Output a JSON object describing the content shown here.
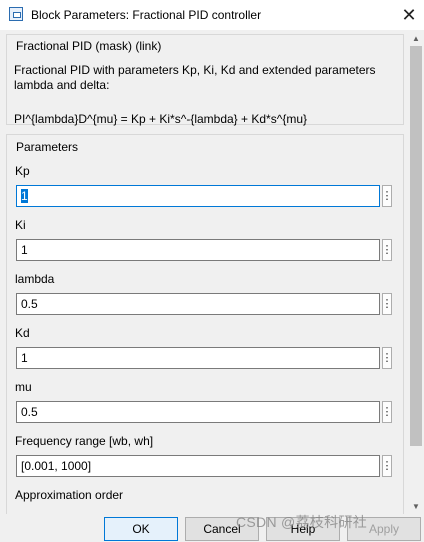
{
  "window": {
    "title": "Block Parameters: Fractional PID controller",
    "close_symbol": "✕"
  },
  "description": {
    "group_title": "Fractional PID (mask) (link)",
    "text": "Fractional PID with parameters Kp, Ki, Kd and extended parameters lambda and delta:",
    "formula": "PI^{lambda}D^{mu} = Kp + Ki*s^-{lambda} + Kd*s^{mu}"
  },
  "parameters": {
    "group_title": "Parameters",
    "fields": [
      {
        "label": "Kp",
        "value": "1"
      },
      {
        "label": "Ki",
        "value": "1"
      },
      {
        "label": "lambda",
        "value": "0.5"
      },
      {
        "label": "Kd",
        "value": "1"
      },
      {
        "label": "mu",
        "value": "0.5"
      },
      {
        "label": "Frequency range [wb, wh]",
        "value": "[0.001, 1000]"
      }
    ],
    "partial_label": "Approximation order",
    "menu_symbol": "⋮"
  },
  "buttons": {
    "ok": "OK",
    "cancel": "Cancel",
    "help": "Help",
    "apply": "Apply"
  },
  "scrollbar": {
    "up_arrow": "▲",
    "down_arrow": "▼"
  },
  "watermark": "CSDN @荔枝科研社"
}
